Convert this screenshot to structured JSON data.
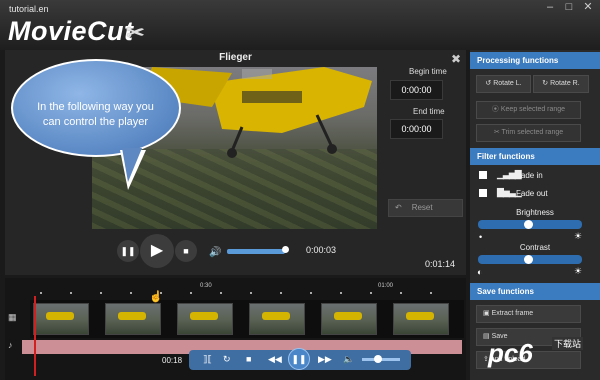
{
  "app": {
    "brand_small": "tutorial.en",
    "brand_logo": "MovieCut",
    "window_buttons": [
      "–",
      "□",
      "✕"
    ]
  },
  "player": {
    "title": "Flieger",
    "close": "✖",
    "begin_time_label": "Begin time",
    "begin_time_value": "0:00:00",
    "end_time_label": "End time",
    "end_time_value": "0:00:00",
    "reset_label": "Reset",
    "current_time": "0:00:03",
    "total_time": "0:01:14",
    "volume_fraction": 0.95
  },
  "bubble": {
    "text": "In the following way you can control the player"
  },
  "panel": {
    "processing_title": "Processing functions",
    "rotate_left": "Rotate L.",
    "rotate_right": "Rotate R.",
    "keep_selected": "Keep selected range",
    "trim_selected": "Trim selected range",
    "filter_title": "Filter functions",
    "fade_in": "Fade in",
    "fade_out": "Fade out",
    "brightness_label": "Brightness",
    "brightness_fraction": 0.5,
    "contrast_label": "Contrast",
    "contrast_fraction": 0.5,
    "save_title": "Save functions",
    "extract_frame": "Extract frame",
    "save_option": "Save",
    "save_option2": "and upload"
  },
  "timeline": {
    "tick_labels": [
      "0:30",
      "01:00"
    ],
    "bottom_time": "00:18"
  },
  "watermark": {
    "main": "pc6",
    "sub": "下载站"
  }
}
